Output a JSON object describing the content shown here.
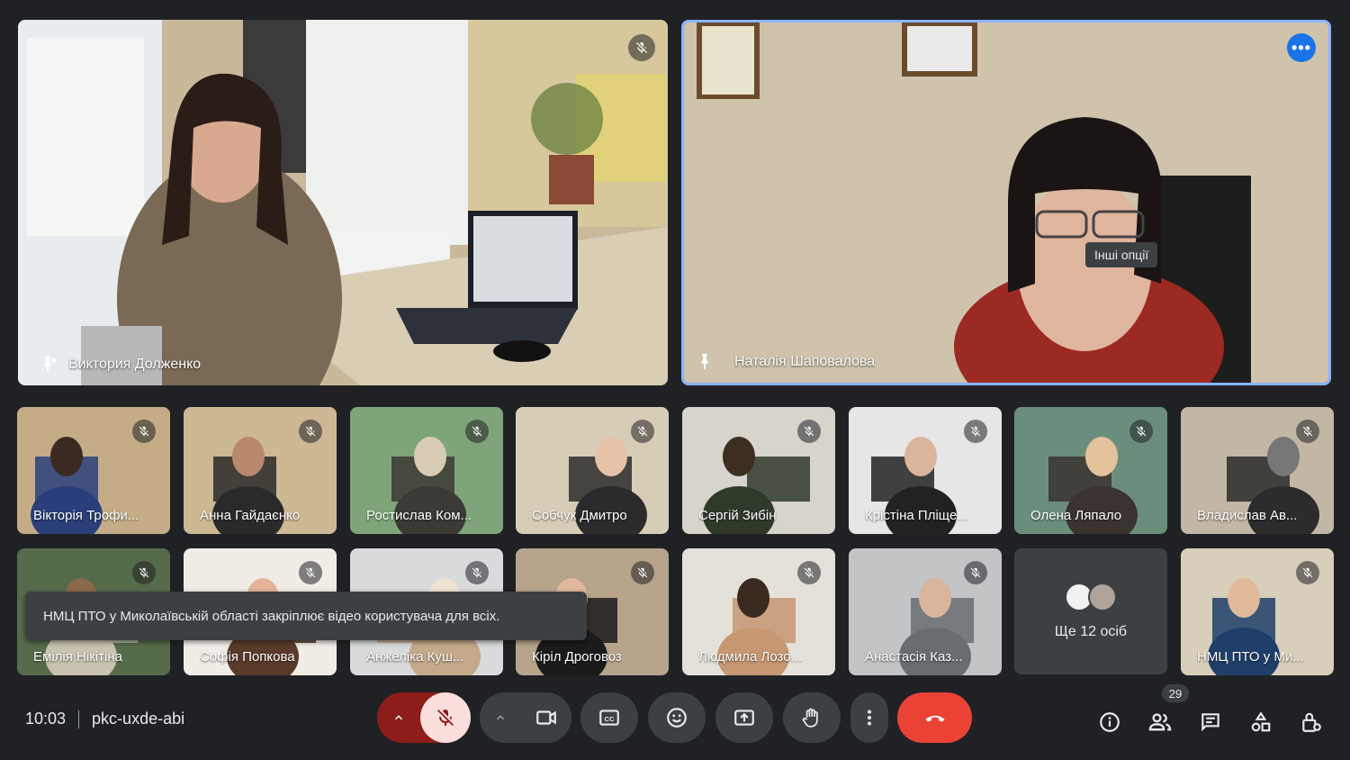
{
  "main_tiles": [
    {
      "name": "Виктория Долженко",
      "muted": true,
      "pinned": false
    },
    {
      "name": "Наталія Шаповалова",
      "muted": false,
      "pinned": true,
      "active": true
    }
  ],
  "tooltip": "Інші опції",
  "small_tiles": [
    {
      "name": "Вікторія Трофи..."
    },
    {
      "name": "Анна Гайдаєнко"
    },
    {
      "name": "Ростислав Ком..."
    },
    {
      "name": "Собчук Дмитро"
    },
    {
      "name": "Сергій Зибін"
    },
    {
      "name": "Крістіна Пліще..."
    },
    {
      "name": "Олена Ляпало"
    },
    {
      "name": "Владислав Ав..."
    },
    {
      "name": "Емілія Нікітіна"
    },
    {
      "name": "Софія Попкова"
    },
    {
      "name": "Анжеліка Куш..."
    },
    {
      "name": "Кіріл Дроговоз"
    },
    {
      "name": "Людмила Лозо..."
    },
    {
      "name": "Анастасія Каз..."
    },
    {
      "name": "НМЦ ПТО у Ми..."
    }
  ],
  "more_people": "Ще 12 осіб",
  "snackbar": "НМЦ ПТО у Миколаївській області закріплює відео користувача для всіх.",
  "bottom_bar": {
    "time": "10:03",
    "meeting_code": "pkc-uxde-abi",
    "participants_count": "29"
  },
  "colors": {
    "background": "#202124",
    "control": "#3c4043",
    "mic_muted_bg": "#f9dedc",
    "mic_muted_group": "#8c1d18",
    "end_call": "#ea4335",
    "accent": "#8ab4f8"
  },
  "icons": [
    "mic-off-icon",
    "pin-icon",
    "camera-icon",
    "captions-icon",
    "emoji-icon",
    "present-icon",
    "hand-icon",
    "more-vert-icon",
    "end-call-icon",
    "info-icon",
    "people-icon",
    "chat-icon",
    "activities-icon",
    "host-controls-icon"
  ]
}
